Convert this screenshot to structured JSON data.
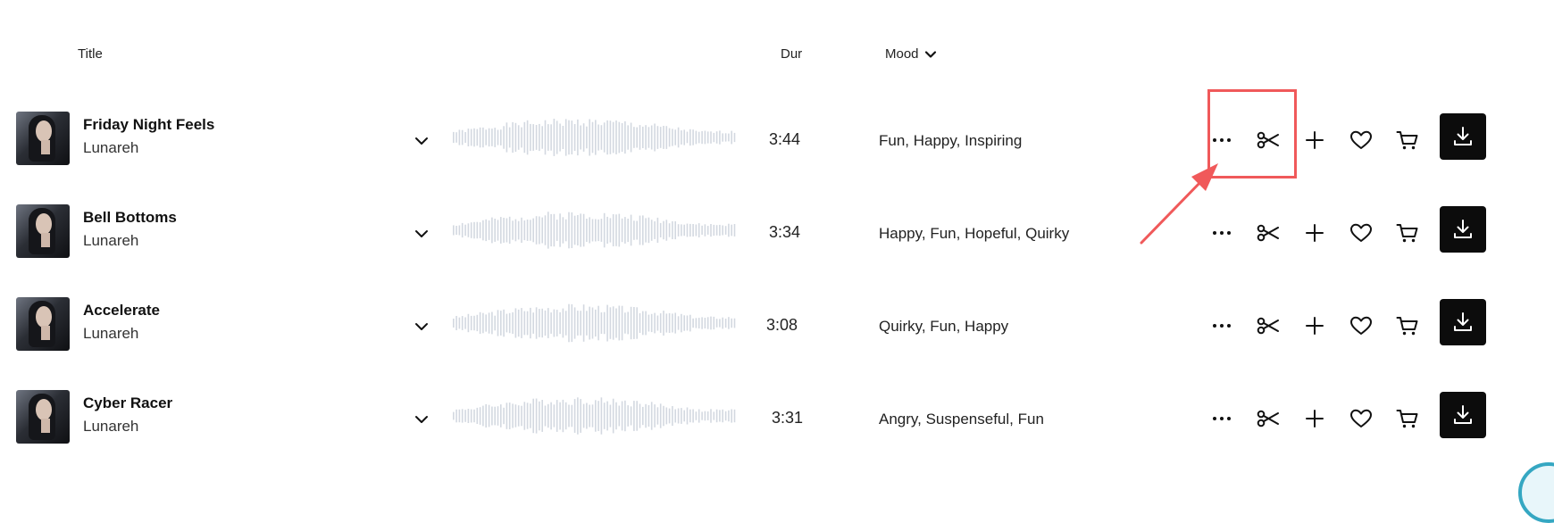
{
  "header": {
    "title": "Title",
    "dur": "Dur",
    "mood": "Mood"
  },
  "tracks": [
    {
      "title": "Friday Night Feels",
      "artist": "Lunareh",
      "duration": "3:44",
      "mood": "Fun, Happy, Inspiring"
    },
    {
      "title": "Bell Bottoms",
      "artist": "Lunareh",
      "duration": "3:34",
      "mood": "Happy, Fun, Hopeful, Quirky"
    },
    {
      "title": "Accelerate",
      "artist": "Lunareh",
      "duration": "3:08",
      "mood": "Quirky, Fun, Happy"
    },
    {
      "title": "Cyber Racer",
      "artist": "Lunareh",
      "duration": "3:31",
      "mood": "Angry, Suspenseful, Fun"
    }
  ],
  "actions": [
    "more-icon",
    "scissors-icon",
    "plus-icon",
    "heart-icon",
    "cart-icon",
    "download-icon"
  ],
  "colors": {
    "highlight": "#f0595a",
    "waveform": "#d3d8e0",
    "download_bg": "#0c0c0c"
  }
}
